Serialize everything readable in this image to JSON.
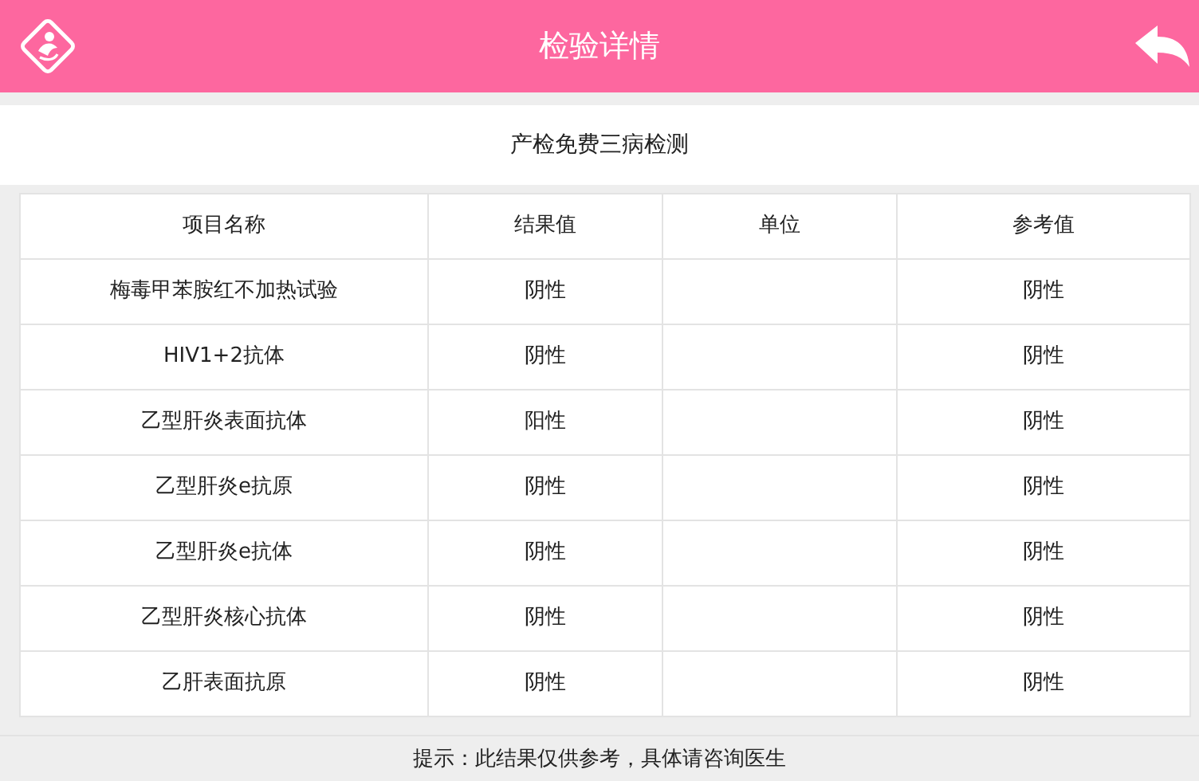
{
  "header": {
    "title": "检验详情"
  },
  "subtitle": "产检免费三病检测",
  "table": {
    "columns": [
      "项目名称",
      "结果值",
      "单位",
      "参考值"
    ],
    "rows": [
      [
        "梅毒甲苯胺红不加热试验",
        "阴性",
        "",
        "阴性"
      ],
      [
        "HIV1+2抗体",
        "阴性",
        "",
        "阴性"
      ],
      [
        "乙型肝炎表面抗体",
        "阳性",
        "",
        "阴性"
      ],
      [
        "乙型肝炎e抗原",
        "阴性",
        "",
        "阴性"
      ],
      [
        "乙型肝炎e抗体",
        "阴性",
        "",
        "阴性"
      ],
      [
        "乙型肝炎核心抗体",
        "阴性",
        "",
        "阴性"
      ],
      [
        "乙肝表面抗原",
        "阴性",
        "",
        "阴性"
      ]
    ]
  },
  "footer": "提示：此结果仅供参考，具体请咨询医生"
}
